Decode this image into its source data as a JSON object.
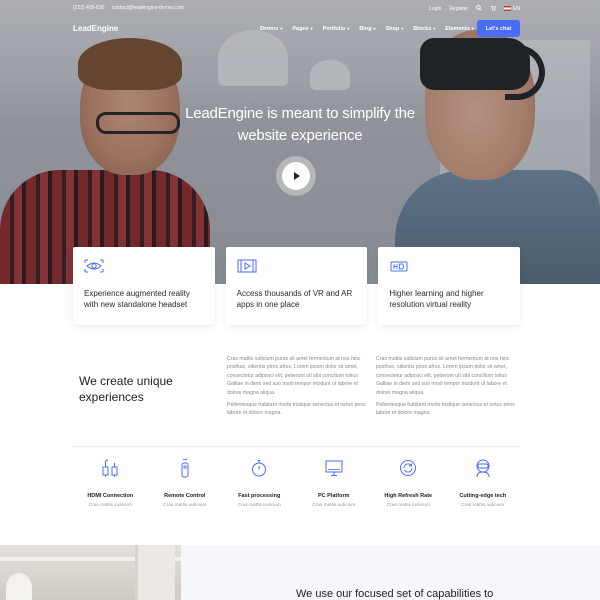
{
  "topbar": {
    "phone": "(222) 400-630",
    "email": "contact@leadengine-theme.com",
    "login": "Login",
    "register": "Register",
    "language": "EN"
  },
  "nav": {
    "logo": "LeadEngine",
    "items": [
      "Demos",
      "Pages",
      "Portfolio",
      "Blog",
      "Shop",
      "Blocks",
      "Elements"
    ],
    "cta": "Let's chat"
  },
  "hero": {
    "title_line1": "LeadEngine is meant to simplify the",
    "title_line2": "website experience"
  },
  "cards": [
    {
      "icon": "eye-icon",
      "line1": "Experience augmented reality",
      "line2": "with new standalone headset"
    },
    {
      "icon": "video-icon",
      "line1": "Access thousands of VR and AR",
      "line2": "apps in one place"
    },
    {
      "icon": "hd-icon",
      "line1": "Higher learning and higher",
      "line2": "resolution virtual reality"
    }
  ],
  "intro": {
    "title_line1": "We create unique",
    "title_line2": "experiences",
    "para1": "Cras mattis iudicium purus sit amet fermentum at nos hinc posthac, sitientis piros afros. Lorem ipsum dolor sit amet, consectetur adipisici elit, petierunt uti sibi concilium totius Galliae in diem sed suo modi tempor incidunt ut labore et dolore magna aliqua.",
    "para1b": "Pellentesque habitant morbi tristique senectus et netus piros labore et dolore magna.",
    "para2": "Cras mattis iudicium purus sit amet fermentum at nos hinc posthac, sitientis piros afros. Lorem ipsum dolor sit amet, consectetur adipisici elit, petierunt uti sibi concilium totius Galliae in diem sed suo modi tempor incidunt ut labore et dolore magna aliqua.",
    "para2b": "Pellentesque habitant morbi tristique senectus et netus piros labore et dolore magna."
  },
  "capabilities": [
    {
      "icon": "hdmi-icon",
      "title": "HDMI Connection",
      "sub": "Cras mattis iudicium"
    },
    {
      "icon": "remote-icon",
      "title": "Remote Control",
      "sub": "Cras mattis iudicium"
    },
    {
      "icon": "stopwatch-icon",
      "title": "Fast processing",
      "sub": "Cras mattis iudicium"
    },
    {
      "icon": "monitor-icon",
      "title": "PC Platform",
      "sub": "Cras mattis iudicium"
    },
    {
      "icon": "refresh-icon",
      "title": "High Refresh Rate",
      "sub": "Cras mattis iudicium"
    },
    {
      "icon": "vr-headset-icon",
      "title": "Cutting-edge tech",
      "sub": "Cras mattis iudicium"
    }
  ],
  "bottom": {
    "title": "We use our focused set of capabilities to"
  },
  "colors": {
    "accent": "#4a6cf7",
    "icon_blue": "#4a6cf7"
  }
}
